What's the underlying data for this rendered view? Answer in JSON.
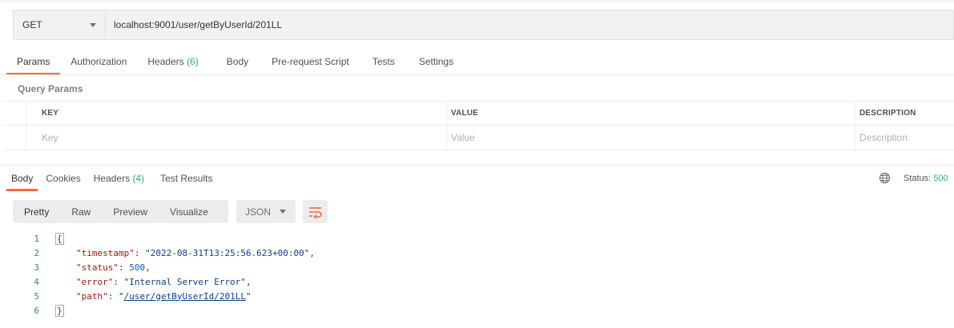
{
  "request": {
    "method": "GET",
    "url": "localhost:9001/user/getByUserId/201LL"
  },
  "request_tabs": [
    {
      "label": "Params",
      "count": ""
    },
    {
      "label": "Authorization",
      "count": ""
    },
    {
      "label": "Headers",
      "count": "(6)"
    },
    {
      "label": "Body",
      "count": ""
    },
    {
      "label": "Pre-request Script",
      "count": ""
    },
    {
      "label": "Tests",
      "count": ""
    },
    {
      "label": "Settings",
      "count": ""
    }
  ],
  "query_params": {
    "title": "Query Params",
    "columns": [
      "KEY",
      "VALUE",
      "DESCRIPTION"
    ],
    "placeholders": {
      "key": "Key",
      "value": "Value",
      "description": "Description"
    }
  },
  "response_tabs": [
    {
      "label": "Body",
      "count": ""
    },
    {
      "label": "Cookies",
      "count": ""
    },
    {
      "label": "Headers",
      "count": "(4)"
    },
    {
      "label": "Test Results",
      "count": ""
    }
  ],
  "status": {
    "label": "Status:",
    "value": "500"
  },
  "view_modes": [
    "Pretty",
    "Raw",
    "Preview",
    "Visualize"
  ],
  "format": "JSON",
  "code": {
    "line_numbers": [
      "1",
      "2",
      "3",
      "4",
      "5",
      "6"
    ],
    "open_brace": "{",
    "close_brace": "}",
    "entries": [
      {
        "key": "\"timestamp\"",
        "sep": ": ",
        "value": "\"2022-08-31T13:25:56.623+00:00\"",
        "trail": ","
      },
      {
        "key": "\"status\"",
        "sep": ": ",
        "value": "500",
        "trail": ","
      },
      {
        "key": "\"error\"",
        "sep": ": ",
        "value": "\"Internal Server Error\"",
        "trail": ","
      },
      {
        "key": "\"path\"",
        "sep": ": ",
        "value_prefix": "\"",
        "value_link": "/user/getByUserId/201LL",
        "value_suffix": "\"",
        "trail": ""
      }
    ]
  },
  "colors": {
    "accent": "#f26b3a",
    "success": "#26b47f",
    "string": "#0a3d8f",
    "key": "#a31515"
  }
}
